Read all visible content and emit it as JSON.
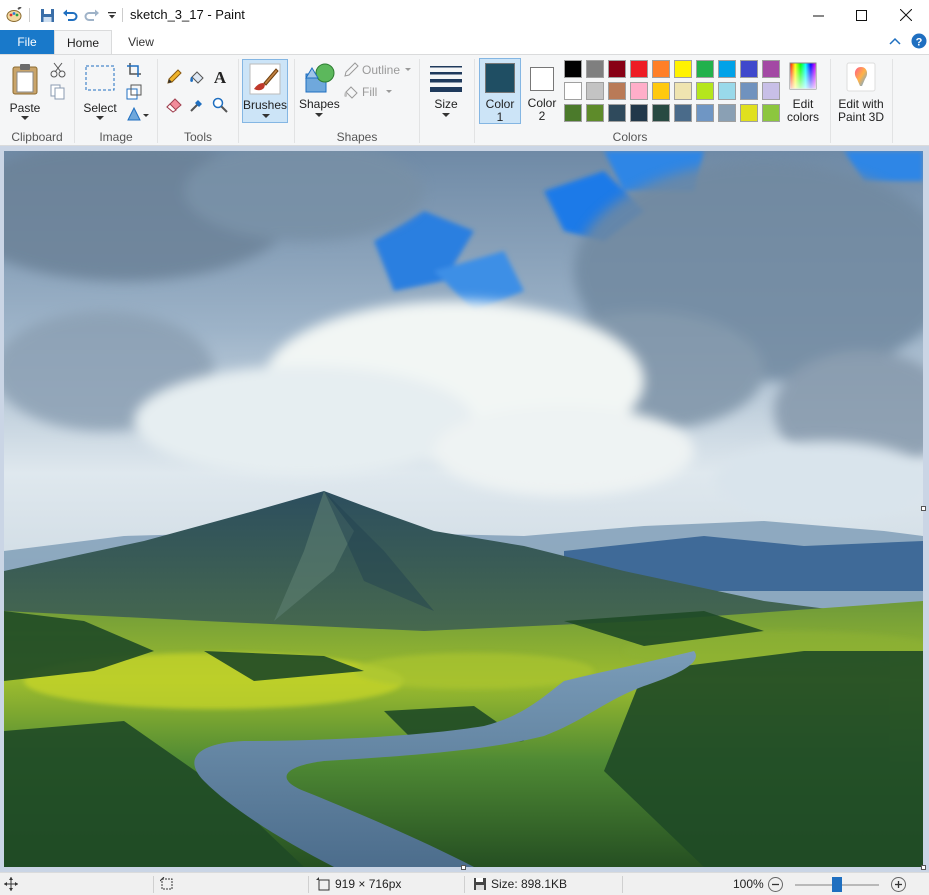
{
  "window": {
    "title": "sketch_3_17 - Paint",
    "minimize_icon": "minimize-icon",
    "maximize_icon": "maximize-icon",
    "close_icon": "close-icon"
  },
  "tabs": {
    "file": "File",
    "home": "Home",
    "view": "View"
  },
  "ribbon": {
    "clipboard": {
      "group": "Clipboard",
      "paste": "Paste"
    },
    "image": {
      "group": "Image",
      "select": "Select"
    },
    "tools": {
      "group": "Tools"
    },
    "brushes": {
      "label": "Brushes"
    },
    "shapes": {
      "group": "Shapes",
      "shapes": "Shapes",
      "outline": "Outline",
      "fill": "Fill"
    },
    "size": {
      "label": "Size"
    },
    "colors": {
      "group": "Colors",
      "color1": "Color",
      "color1_num": "1",
      "color2": "Color",
      "color2_num": "2",
      "edit1": "Edit",
      "edit2": "colors",
      "paint3d1": "Edit with",
      "paint3d2": "Paint 3D",
      "color1_value": "#1f4e63",
      "color2_value": "#ffffff",
      "palette": [
        [
          "#000000",
          "#7f7f7f",
          "#880015",
          "#ed1c24",
          "#ff7f27",
          "#fff200",
          "#22b14c",
          "#00a2e8",
          "#3f48cc",
          "#a349a4"
        ],
        [
          "#ffffff",
          "#c3c3c3",
          "#b97a57",
          "#ffaec9",
          "#ffc90e",
          "#efe4b0",
          "#b5e61d",
          "#99d9ea",
          "#7092be",
          "#c8bfe7"
        ],
        [
          "#4b7a2b",
          "#5e8b2a",
          "#2f4a5c",
          "#22384a",
          "#284a42",
          "#4a6b8a",
          "#6f96c4",
          "#8aa0b4",
          "#e0e01e",
          "#8cc63f"
        ]
      ]
    }
  },
  "status": {
    "dimensions": "919 × 716px",
    "size": "Size: 898.1KB",
    "zoom": "100%",
    "zoom_level": 0.5
  }
}
